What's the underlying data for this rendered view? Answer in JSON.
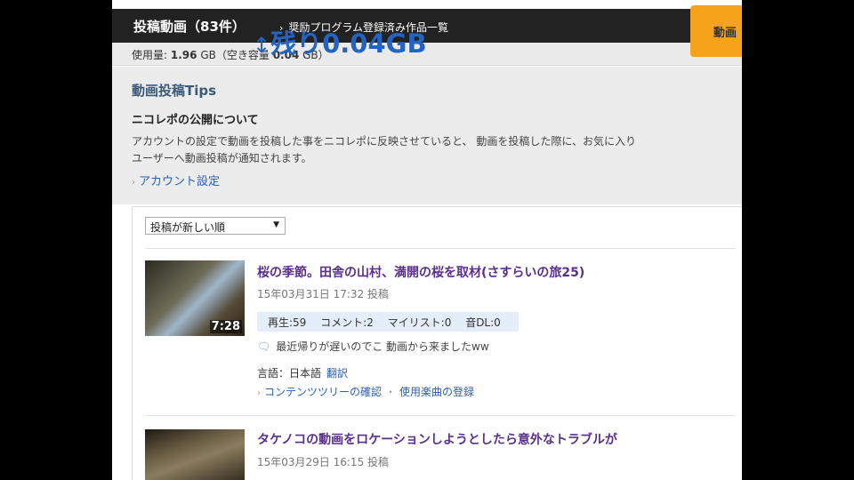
{
  "header": {
    "title": "投稿動画（83件）",
    "breadcrumb_arrow": "›",
    "breadcrumb": "奨励プログラム登録済み作品一覧",
    "orange_button": "動画"
  },
  "usage": {
    "label": "使用量:",
    "used": "1.96",
    "unit": "GB",
    "free_label": "（空き容量",
    "free": "0.04",
    "free_unit": "GB）"
  },
  "overlay": {
    "arrow": "↕",
    "text": "残り0.04GB"
  },
  "tips": {
    "title": "動画投稿Tips",
    "subtitle": "ニコレポの公開について",
    "body_line1": "アカウントの設定で動画を投稿した事をニコレポに反映させていると、 動画を投稿した際に、お気に入り",
    "body_line2": "ユーザーへ動画投稿が通知されます。",
    "link": "アカウント設定"
  },
  "sort": {
    "selected": "投稿が新しい順",
    "caret": "▼"
  },
  "videos": [
    {
      "title": "桜の季節。田舎の山村、満開の桜を取材(さすらいの旅25)",
      "date": "15年03月31日 17:32 投稿",
      "duration": "7:28",
      "stats": {
        "plays": "再生:59",
        "comments": "コメント:2",
        "mylist": "マイリスト:0",
        "audio_dl": "音DL:0"
      },
      "comment": "最近帰りが遅いのでこ 動画から来ましたww",
      "lang_label": "言語：日本語",
      "translate": "翻訳",
      "link1": "コンテンツツリーの確認",
      "link2": "使用楽曲の登録"
    },
    {
      "title": "タケノコの動画をロケーションしようとしたら意外なトラブルが",
      "date": "15年03月29日 16:15 投稿"
    }
  ],
  "icons": {
    "link_arrow": "›",
    "comment_bubble": "comment-bubble-icon"
  }
}
